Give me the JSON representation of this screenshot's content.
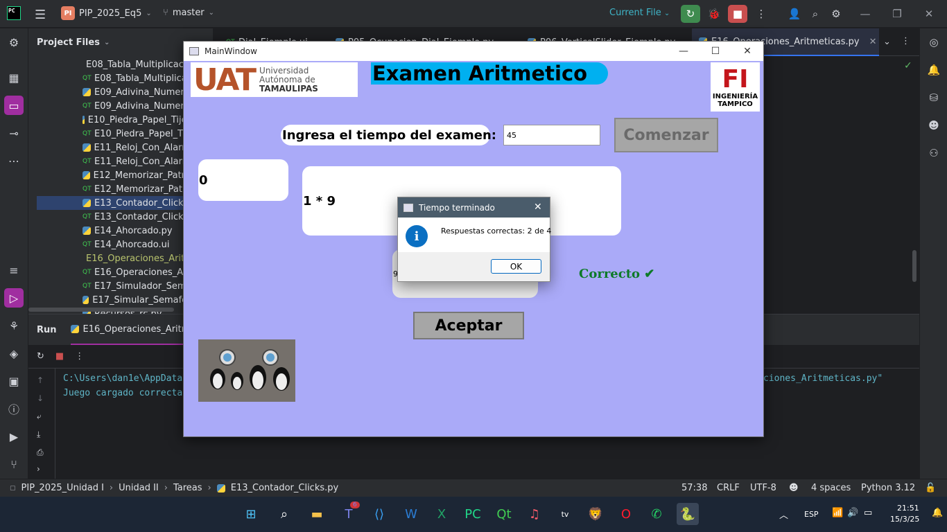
{
  "ide": {
    "project_name": "PIP_2025_Eq5",
    "project_badge": "PI",
    "branch": "master",
    "current_file_label": "Current File",
    "project_files_label": "Project Files",
    "tabs": [
      {
        "label": "Dial_Ejemplo.ui"
      },
      {
        "label": "P05_Ocupacion_Dial_Ejemplo.py"
      },
      {
        "label": "P06_VerticalSlider_Ejemplo.py"
      },
      {
        "label": "E16_Operaciones_Aritmeticas.py"
      }
    ],
    "tree": [
      {
        "label": "E08_Tabla_Multiplicacion.py",
        "kind": "py"
      },
      {
        "label": "E08_Tabla_Multiplicacion.ui",
        "kind": "qt"
      },
      {
        "label": "E09_Adivina_Numero.py",
        "kind": "py"
      },
      {
        "label": "E09_Adivina_Numero.ui",
        "kind": "qt"
      },
      {
        "label": "E10_Piedra_Papel_Tijera.py",
        "kind": "py"
      },
      {
        "label": "E10_Piedra_Papel_Tijera.ui",
        "kind": "qt"
      },
      {
        "label": "E11_Reloj_Con_Alarma.py",
        "kind": "py"
      },
      {
        "label": "E11_Reloj_Con_Alarma.ui",
        "kind": "qt"
      },
      {
        "label": "E12_Memorizar_Patron.py",
        "kind": "py"
      },
      {
        "label": "E12_Memorizar_Patron.ui",
        "kind": "qt"
      },
      {
        "label": "E13_Contador_Clicks.py",
        "kind": "py"
      },
      {
        "label": "E13_Contador_Clicks.ui",
        "kind": "qt"
      },
      {
        "label": "E14_Ahorcado.py",
        "kind": "py"
      },
      {
        "label": "E14_Ahorcado.ui",
        "kind": "qt"
      },
      {
        "label": "E16_Operaciones_Aritmeticas.py",
        "kind": "py"
      },
      {
        "label": "E16_Operaciones_Aritmeticas.ui",
        "kind": "qt"
      },
      {
        "label": "E17_Simulador_Semaforo.ui",
        "kind": "qt"
      },
      {
        "label": "E17_Simular_Semaforo.py",
        "kind": "py"
      },
      {
        "label": "Recursos_rc.py",
        "kind": "py"
      }
    ],
    "run": {
      "tab_label": "Run",
      "config": "E16_Operaciones_Aritmeticas",
      "console_line1": "C:\\Users\\dan1e\\AppData",
      "console_line1_end": "ciones_Aritmeticas.py\"",
      "console_line2": "Juego cargado correcta"
    },
    "status": {
      "crumbs": [
        "PIP_2025_Unidad I",
        "Unidad II",
        "Tareas",
        "E13_Contador_Clicks.py"
      ],
      "position": "57:38",
      "line_sep": "CRLF",
      "encoding": "UTF-8",
      "indent": "4 spaces",
      "interpreter": "Python 3.12"
    }
  },
  "app": {
    "window_title": "MainWindow",
    "uat_big": "UAT",
    "uat_line1": "Universidad",
    "uat_line2": "Autónoma de",
    "uat_line3": "TAMAULIPAS",
    "heading": "Examen Aritmetico",
    "fi_logo": "FI",
    "fi_line1": "INGENIERÍA",
    "fi_line2": "TAMPICO",
    "time_label": "Ingresa el tiempo del examen:",
    "time_value": "45",
    "start_button": "Comenzar",
    "counter": "0",
    "question": "1 * 9",
    "answer_value": "9",
    "result": "Correcto ✔",
    "accept_button": "Aceptar"
  },
  "dialog": {
    "title": "Tiempo terminado",
    "message": "Respuestas correctas: 2 de 4",
    "ok": "OK",
    "info_glyph": "i"
  },
  "taskbar": {
    "language": "ESP",
    "time": "21:51",
    "date": "15/3/25",
    "teams_badge": "6"
  },
  "colors": {
    "app_background": "#aaaaf8",
    "result_green": "#0d7a28",
    "heading_bar": "#00b0f0",
    "ide_bg": "#1e1f22",
    "console_text": "#5fb5c7"
  }
}
